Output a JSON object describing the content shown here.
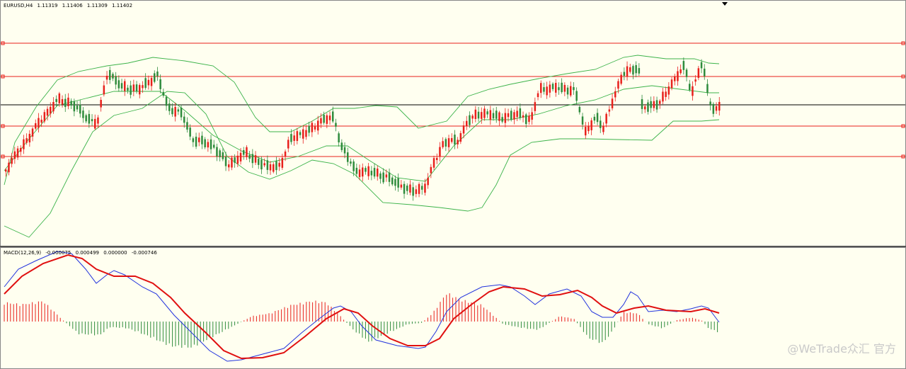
{
  "chart": {
    "symbol": "EURUSD,H4",
    "ohlc": [
      "1.11319",
      "1.11406",
      "1.11309",
      "1.11402"
    ]
  },
  "macd": {
    "label": "MACD(12,26,9)",
    "values": [
      "-0.000075",
      "0.000499",
      "0.000000",
      "-0.000746"
    ]
  },
  "watermark": "@WeTrade众汇 官方",
  "colors": {
    "background": "#fffff0",
    "bull": "#e8201c",
    "bear": "#2e8b3c",
    "band": "#3cb34a",
    "level": "#e8201c",
    "macd_line": "#2233dd",
    "signal_line": "#e01010"
  },
  "chart_data": [
    {
      "type": "candlestick",
      "symbol": "EURUSD",
      "timeframe": "H4",
      "last": {
        "open": 1.11319,
        "high": 1.11406,
        "low": 1.11309,
        "close": 1.11402
      },
      "overlays": [
        "bollinger-bands",
        "horizontal-levels"
      ],
      "grid": false
    },
    {
      "type": "line",
      "name": "MACD(12,26,9)",
      "values": [
        -7.5e-05,
        0.000499,
        0.0,
        -0.000746
      ],
      "grid": false
    }
  ]
}
